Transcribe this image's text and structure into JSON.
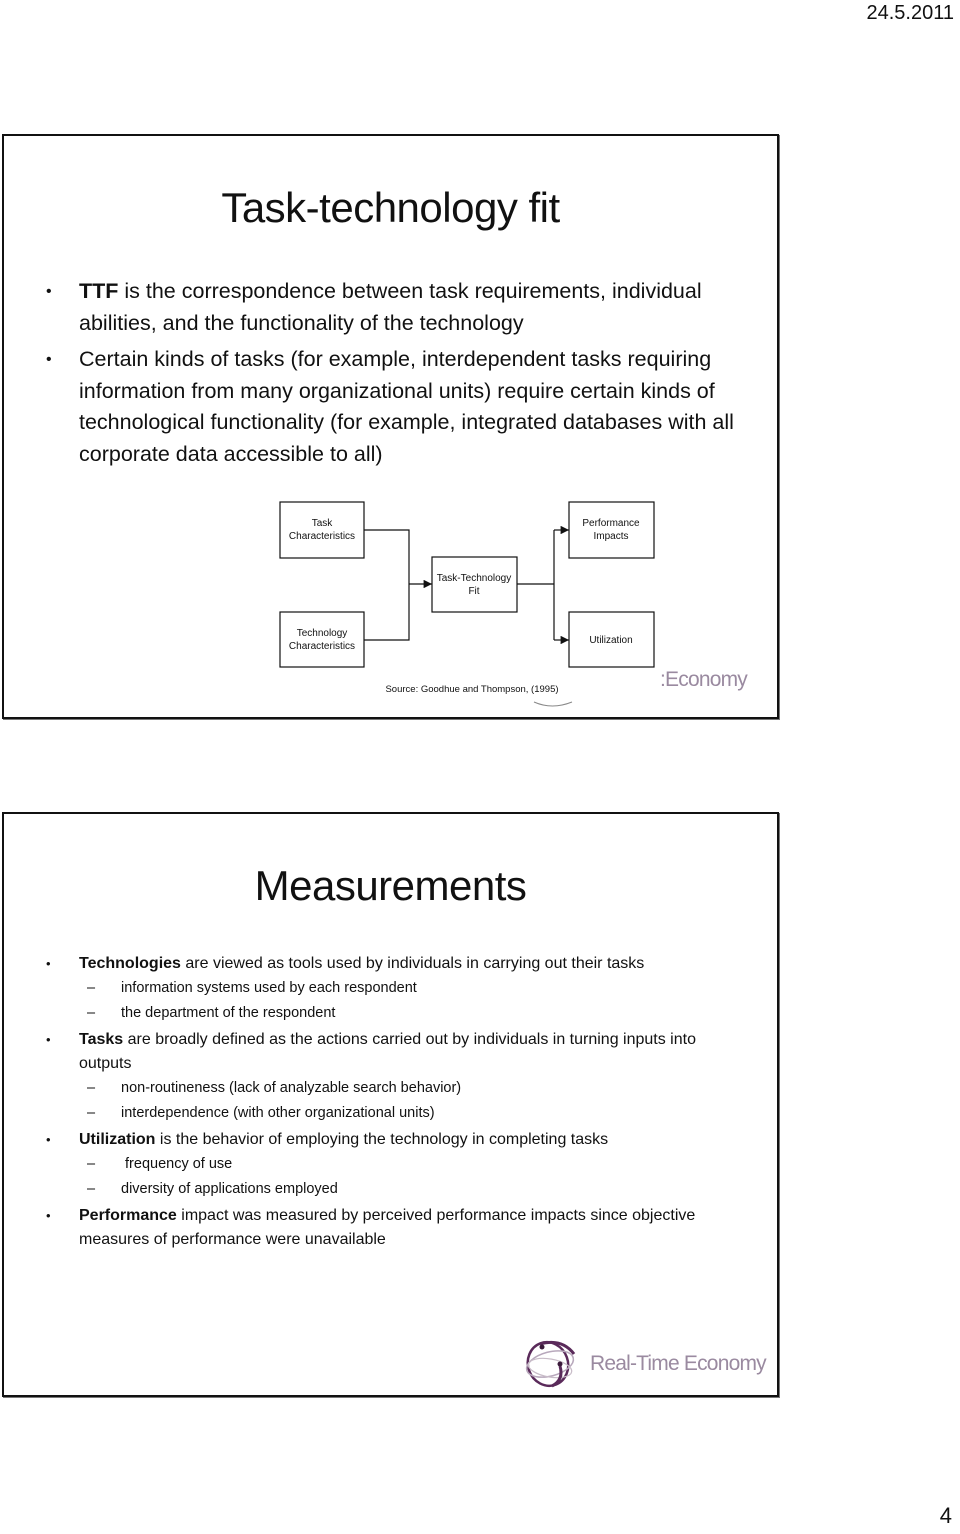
{
  "page": {
    "date": "24.5.2011",
    "page_number": "4"
  },
  "slide1": {
    "title": "Task-technology fit",
    "bullets": [
      {
        "term": "TTF",
        "text": " is the correspondence between task requirements, individual abilities, and the functionality of the technology"
      },
      {
        "term": "",
        "text": "Certain kinds of tasks (for example, interdependent tasks requiring information from many organizational units) require certain kinds of technological functionality (for example, integrated databases with all corporate data accessible to all)"
      }
    ],
    "diagram": {
      "boxes": {
        "task_characteristics": [
          "Task",
          "Characteristics"
        ],
        "technology_characteristics": [
          "Technology",
          "Characteristics"
        ],
        "task_technology_fit": [
          "Task-Technology",
          "Fit"
        ],
        "performance_impacts": [
          "Performance",
          "Impacts"
        ],
        "utilization": [
          "Utilization"
        ]
      },
      "source": "Source: Goodhue and Thompson, (1995)"
    },
    "logo_partial_text": ":Economy"
  },
  "slide2": {
    "title": "Measurements",
    "bullets": [
      {
        "term": "Technologies",
        "text": " are viewed as tools used by individuals in carrying out their tasks",
        "sub": [
          "information systems used by each respondent",
          "the department of the respondent"
        ]
      },
      {
        "term": "Tasks",
        "text": " are broadly defined as the actions carried out by individuals in turning inputs into outputs",
        "sub": [
          "non-routineness (lack  of analyzable search behavior)",
          "interdependence (with other organizational units)"
        ]
      },
      {
        "term": "Utilization",
        "text": " is the behavior of employing the technology in completing tasks",
        "sub": [
          " frequency of use",
          "diversity of applications employed"
        ]
      },
      {
        "term": "Performance",
        "text": " impact was measured by perceived performance impacts since objective measures  of performance were unavailable",
        "sub": []
      }
    ],
    "logo_text": "Real-Time Economy"
  },
  "colors": {
    "logo_text": "#9a8aa0",
    "logo_globe": "#5a2a5a",
    "frame": "#111111"
  }
}
